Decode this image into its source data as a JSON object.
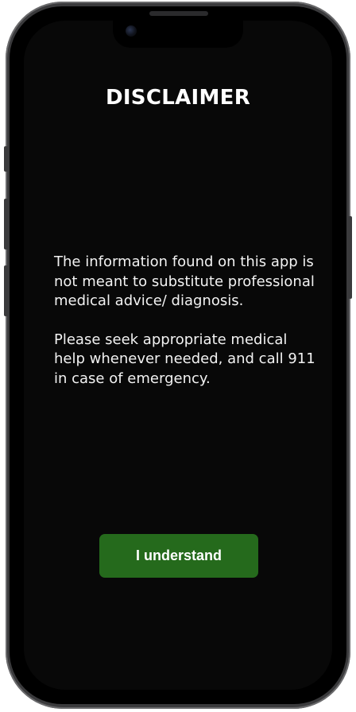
{
  "screen": {
    "title": "DISCLAIMER",
    "paragraphs": [
      "The information found on this app is not meant to substitute professional medical advice/ diagnosis.",
      "Please seek appropriate medical help whenever needed, and call 911 in case of emergency."
    ],
    "button_label": "I understand"
  },
  "colors": {
    "background": "#080808",
    "button": "#256a1c",
    "text": "#ffffff"
  }
}
